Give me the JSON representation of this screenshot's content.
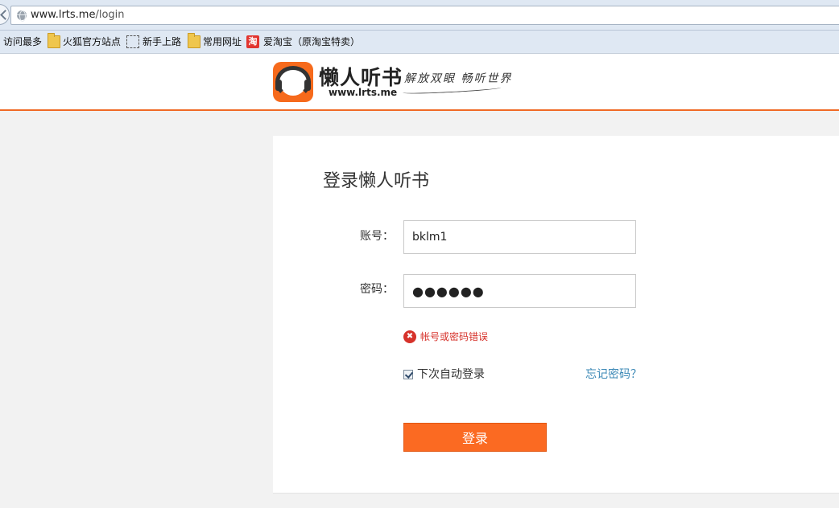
{
  "browser": {
    "url_host": "www.lrts.me",
    "url_path": "/login",
    "bookmarks": [
      {
        "label": "访问最多",
        "icon": "none"
      },
      {
        "label": "火狐官方站点",
        "icon": "folder-icon"
      },
      {
        "label": "新手上路",
        "icon": "dashed-page-icon"
      },
      {
        "label": "常用网址",
        "icon": "folder-icon"
      },
      {
        "label": "爱淘宝（原淘宝特卖）",
        "icon": "taobao-icon",
        "icon_glyph": "淘"
      }
    ]
  },
  "site": {
    "logo_title": "懒人听书",
    "logo_domain": "www.lrts.me",
    "logo_slogan": "解放双眼 畅听世界",
    "brand_color": "#f66a1c"
  },
  "login": {
    "title": "登录懒人听书",
    "account_label": "账号：",
    "account_value": "bklm1",
    "password_label": "密码：",
    "password_masked": "●●●●●●",
    "error_glyph": "✖",
    "error_message": "帐号或密码错误",
    "remember_label": "下次自动登录",
    "remember_checked": true,
    "forgot_label": "忘记密码？",
    "submit_label": "登录",
    "error_color": "#d6322b",
    "button_color": "#fb6a22",
    "link_color": "#3b88b6"
  }
}
